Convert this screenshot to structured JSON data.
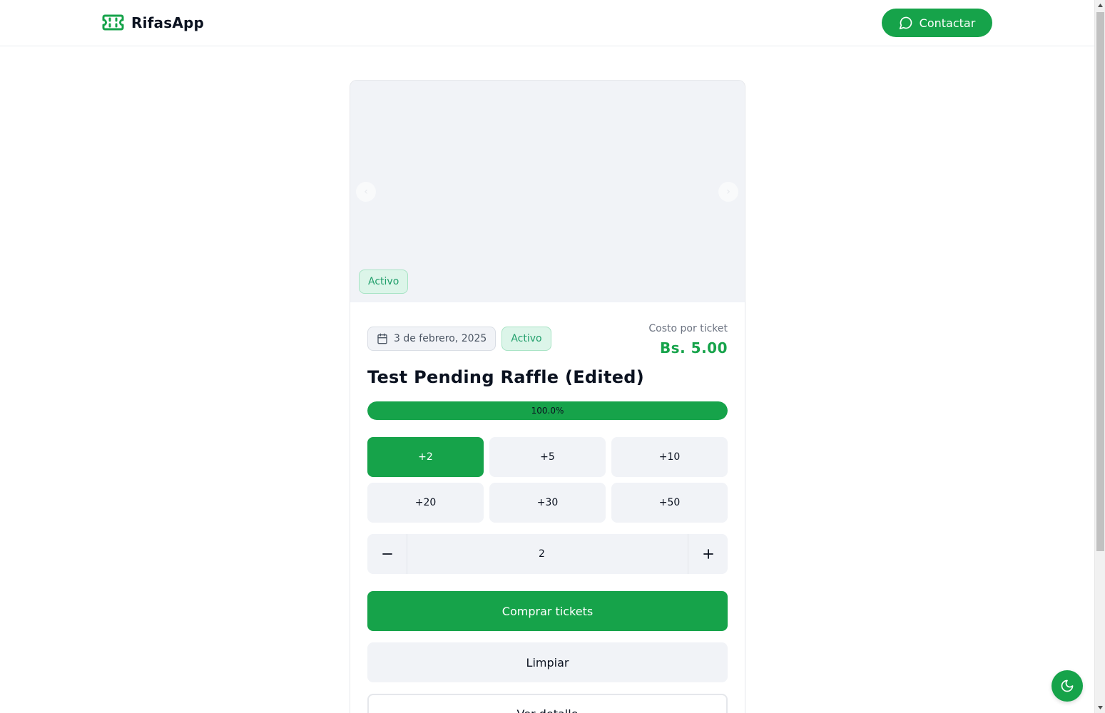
{
  "header": {
    "brand_name": "RifasApp",
    "brand_icon": "ticket-icon",
    "contact_label": "Contactar",
    "contact_icon": "message-circle-icon"
  },
  "raffle": {
    "media_status_badge": "Activo",
    "date": "3 de febrero, 2025",
    "status": "Activo",
    "price_label": "Costo por ticket",
    "price_value": "Bs. 5.00",
    "title": "Test Pending Raffle (Edited)",
    "progress_text": "100.0%",
    "progress_fraction": 1.0
  },
  "quantity_options": [
    {
      "label": "+2",
      "selected": true
    },
    {
      "label": "+5",
      "selected": false
    },
    {
      "label": "+10",
      "selected": false
    },
    {
      "label": "+20",
      "selected": false
    },
    {
      "label": "+30",
      "selected": false
    },
    {
      "label": "+50",
      "selected": false
    }
  ],
  "stepper": {
    "value": "2",
    "decrement_icon": "minus-icon",
    "increment_icon": "plus-icon"
  },
  "actions": {
    "buy_label": "Comprar tickets",
    "clear_label": "Limpiar",
    "detail_label": "Ver detalle"
  },
  "theme_toggle_icon": "moon-icon",
  "colors": {
    "accent": "#16a34a",
    "badge_bg": "#dcf5e9",
    "badge_text": "#1f9e6a",
    "surface": "#f1f3f7"
  }
}
